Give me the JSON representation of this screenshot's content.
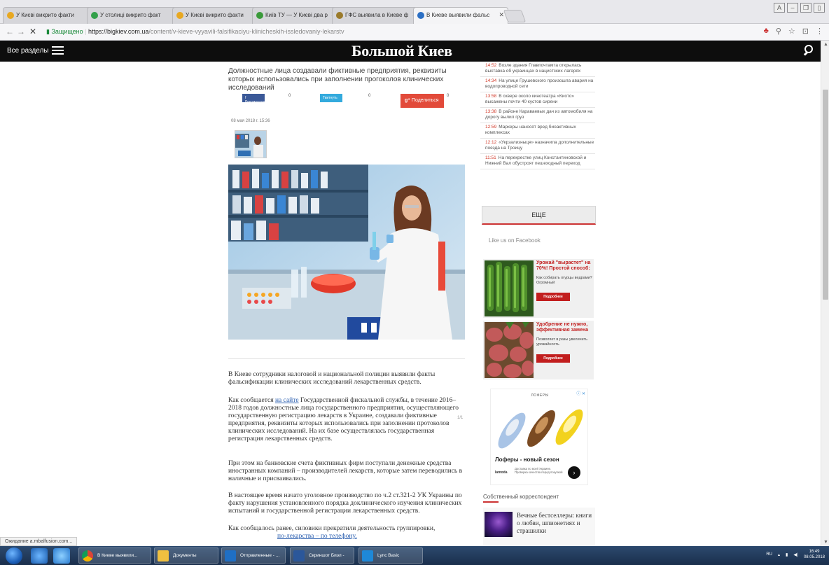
{
  "browser": {
    "tabs": [
      {
        "label": "У Києві викрито факти",
        "color": "#e8a820",
        "active": false
      },
      {
        "label": "У столиці викрито факт",
        "color": "#33a04a",
        "active": false
      },
      {
        "label": "У Києві викрито факти",
        "color": "#e8a820",
        "active": false
      },
      {
        "label": "Київ ТУ — У Києві два р",
        "color": "#3a9a3a",
        "active": false
      },
      {
        "label": "ГФС выявила в Киеве ф",
        "color": "#9a7a2a",
        "active": false
      },
      {
        "label": "В Киеве выявили фальс",
        "color": "#2b6fc4",
        "active": true
      }
    ],
    "secure_label": "Защищено",
    "url_host": "https://bigkiev.com.ua",
    "url_path": "/content/v-kieve-vyyavili-falsifikaciyu-klinicheskih-issledovaniy-lekarstv"
  },
  "site": {
    "all_sections": "Все разделы",
    "logo": "Большой Киев"
  },
  "article": {
    "lead": "Должностные лица создавали фиктивные предприятия, реквизиты которых использовались при заполнении прогоколов клинических исследований",
    "share_fb": "f Рекомендувати",
    "share_tw": "Твитнуть",
    "share_gp": "Поделиться",
    "count_fb": "0",
    "count_tw": "0",
    "count_gp": "0",
    "date": "08 мая 2018 г. 15:36",
    "photo_count": "1/1",
    "p1": "В Киеве сотрудники налоговой и национальной полиции выявили факты фальсификации клинических исследований лекарственных средств.",
    "p2_prefix": "Как сообщается ",
    "p2_link": "на сайте",
    "p2_rest": " Государственной фискальной службы, в течение 2016–2018 годов должностные лица государственного предприятия, осуществляющего государственную регистрацию лекарств в Украине, создавали фиктивные предприятия, реквизиты которых использовались при заполнении протоколов клинических исследований. На их базе  осуществлялась государственная регистрация лекарственных средств.",
    "p3": "При этом на банковские счета фиктивных фирм поступали денежные средства иностранных компаний – производителей лекарств, которые затем переводились в наличные и присваивались.",
    "p4": "В настоящее время начато уголовное производство по ч.2 ст.321-2 УК Украины по факту нарушения установленного порядка доклинического изучения клинических испытаний и государственной регистрации лекарственных средств.",
    "p5": "Как сообщалось ранее, силовики прекратили деятельность группировки,",
    "p5_link": "по-лекарства – по телефону."
  },
  "sidebar": {
    "news": [
      {
        "time": "14:52",
        "text": "Возле здания Главпочтамта открылась выставка об украинцах в нацистских лагерях"
      },
      {
        "time": "14:34",
        "text": "На улице Грушевского произошла авария на водопроводной сети"
      },
      {
        "time": "13:58",
        "text": "В сквере около кинотеатра «Киото» высажены почти 40 кустов сирени"
      },
      {
        "time": "13:38",
        "text": "В районе Караваевых дач из автомобиля на дорогу вылил груз"
      },
      {
        "time": "12:59",
        "text": "Маркеры наносят вред биоактивных комплексах"
      },
      {
        "time": "12:12",
        "text": "«Укрзализныця» назначила дополнительные поезда на Троицу"
      },
      {
        "time": "11:51",
        "text": "На перекрестке улиц Константиновской и Нижний Вал обустроят пешеходный переход"
      }
    ],
    "more_label": "ЕЩЕ",
    "facebook_title": "Like us on Facebook",
    "ads": [
      {
        "title": "Урожай \"вырастет\" на 70%! Простой способ:",
        "sub": "Как собирать огурцы ведрами? Огромный",
        "button": "Подробнее"
      },
      {
        "title": "Удобрение не нужно, эффективная замена",
        "sub": "Позволяет в разы увеличить урожайность",
        "button": "Подробнее"
      }
    ],
    "shoe_ad": {
      "brand": "ЛОФЕРЫ",
      "adchoice": "ⓘ ✕",
      "headline": "Лоферы - новый сезон",
      "advertiser": "lamoda",
      "desc": "Доставка по всей Украине. Проверка качества перед покупкой",
      "go": "›"
    },
    "correspondent_title": "Собственный корреспондент",
    "correspondent_text": "Вечные бестселлеры: книги о любви, шпионетиях и страшилки"
  },
  "status_text": "Ожидание a.mbalfusion.com...",
  "taskbar": {
    "tasks": [
      {
        "label": "В Киеве выявили...",
        "color": "#e8e8e8"
      },
      {
        "label": "Документы",
        "color": "#f0c040"
      },
      {
        "label": "Отправленные - ...",
        "color": "#1f6fc4"
      },
      {
        "label": "Скриншот Биэл -",
        "color": "#2b579a"
      },
      {
        "label": "Lync Basic",
        "color": "#1e88d8"
      }
    ],
    "lang": "RU",
    "time": "16:49",
    "date": "08.05.2018"
  },
  "colors": {
    "accent_red": "#c33",
    "header_bg": "#0d0d0d",
    "link": "#2b5fb0"
  }
}
